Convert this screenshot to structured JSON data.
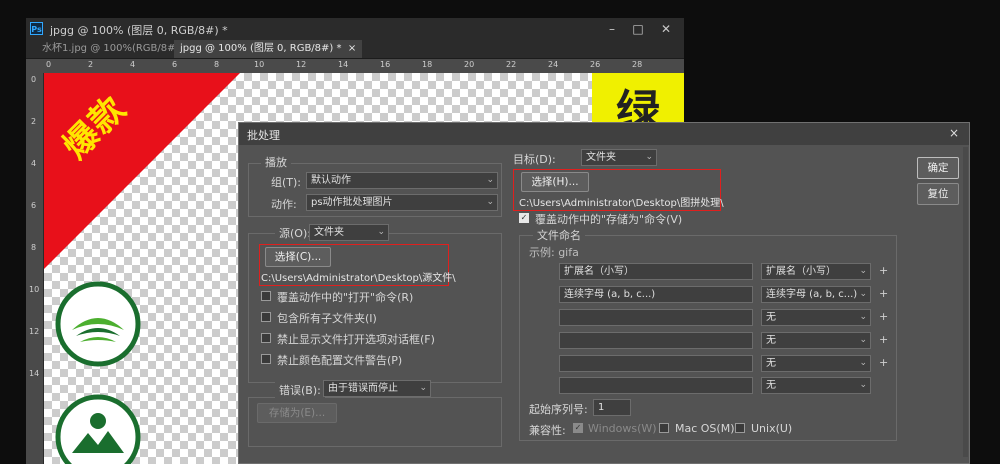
{
  "ps_window": {
    "title": "jpgg @ 100% (图层 0, RGB/8#) *",
    "logo": "Ps",
    "tabs": [
      {
        "label": "水杯1.jpg @ 100%(RGB/8#)"
      },
      {
        "label": "jpgg @ 100% (图层 0, RGB/8#) *",
        "close": "×"
      }
    ],
    "ruler_h": [
      "0",
      "2",
      "4",
      "6",
      "8",
      "10",
      "12",
      "14",
      "16",
      "18",
      "20",
      "22",
      "24",
      "26",
      "28"
    ],
    "ruler_v": [
      "0",
      "2",
      "4",
      "6",
      "8",
      "10",
      "12",
      "14"
    ],
    "canvas": {
      "banner_text": "爆款",
      "green_char": "绿"
    }
  },
  "dialog": {
    "title": "批处理",
    "close": "×",
    "play": {
      "legend": "播放",
      "group_label": "组(T):",
      "group_value": "默认动作",
      "action_label": "动作:",
      "action_value": "ps动作批处理图片"
    },
    "source": {
      "label": "源(O):",
      "value": "文件夹",
      "choose_button": "选择(C)...",
      "path": "C:\\Users\\Administrator\\Desktop\\源文件\\",
      "options": [
        {
          "label": "覆盖动作中的\"打开\"命令(R)",
          "checked": false
        },
        {
          "label": "包含所有子文件夹(I)",
          "checked": false
        },
        {
          "label": "禁止显示文件打开选项对话框(F)",
          "checked": false
        },
        {
          "label": "禁止颜色配置文件警告(P)",
          "checked": false
        }
      ]
    },
    "errors": {
      "label": "错误(B):",
      "value": "由于错误而停止",
      "save_as_button": "存储为(E)..."
    },
    "destination": {
      "label": "目标(D):",
      "value": "文件夹",
      "choose_button": "选择(H)...",
      "path": "C:\\Users\\Administrator\\Desktop\\图拼处理\\",
      "override_save": {
        "label": "覆盖动作中的\"存储为\"命令(V)",
        "checked": true
      }
    },
    "file_naming": {
      "legend": "文件命名",
      "example": "示例: gifa",
      "rows": [
        {
          "field": "扩展名（小写）",
          "select": "扩展名（小写）"
        },
        {
          "field": "连续字母 (a, b, c...)",
          "select": "连续字母 (a, b, c...)"
        },
        {
          "field": "",
          "select": "无"
        },
        {
          "field": "",
          "select": "无"
        },
        {
          "field": "",
          "select": "无"
        },
        {
          "field": "",
          "select": "无"
        }
      ],
      "start_serial_label": "起始序列号:",
      "start_serial_value": "1",
      "compat_label": "兼容性:",
      "compat": [
        {
          "label": "Windows(W)",
          "checked": true,
          "disabled": true
        },
        {
          "label": "Mac OS(M)",
          "checked": false
        },
        {
          "label": "Unix(U)",
          "checked": false
        }
      ]
    },
    "ok_button": "确定",
    "reset_button": "复位"
  }
}
